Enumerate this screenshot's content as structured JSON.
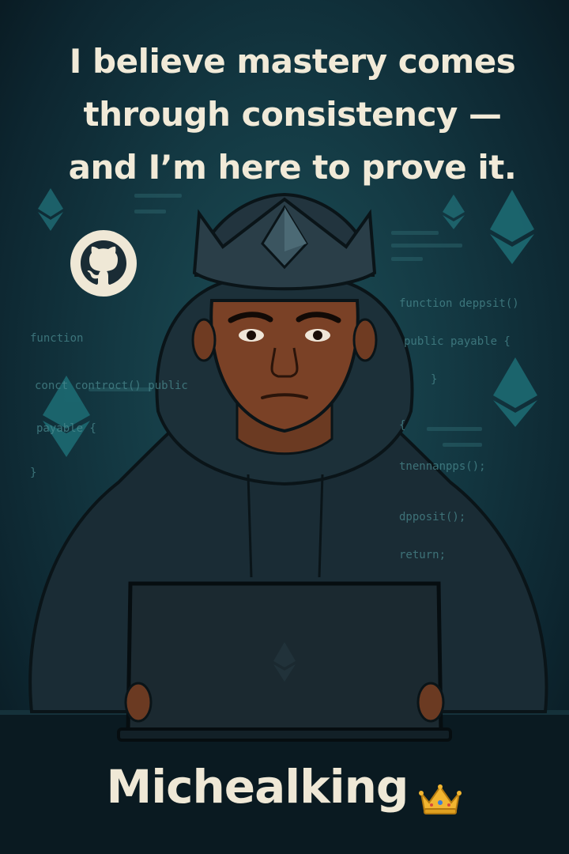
{
  "poster": {
    "quote_lines": [
      "I believe mastery comes",
      "through consistency —",
      "and I’m here to prove it."
    ],
    "name": "Michealking",
    "brand_icon": "crown-icon",
    "logo_icon": "github-icon",
    "colors": {
      "text": "#f1ead8",
      "background": "#143a44",
      "code": "#4a8a8f",
      "hoodie": "#1a2c35"
    }
  },
  "code_left": {
    "line1": "function",
    "line2": "conct controct() public",
    "line3": "payable {",
    "line4": "}"
  },
  "code_right": {
    "line1": "function deppsit()",
    "line2": "public payable {",
    "line3": "}",
    "line4": "{",
    "line5": "tnennanpps();",
    "line6": "dpposit();",
    "line7": "return;"
  }
}
